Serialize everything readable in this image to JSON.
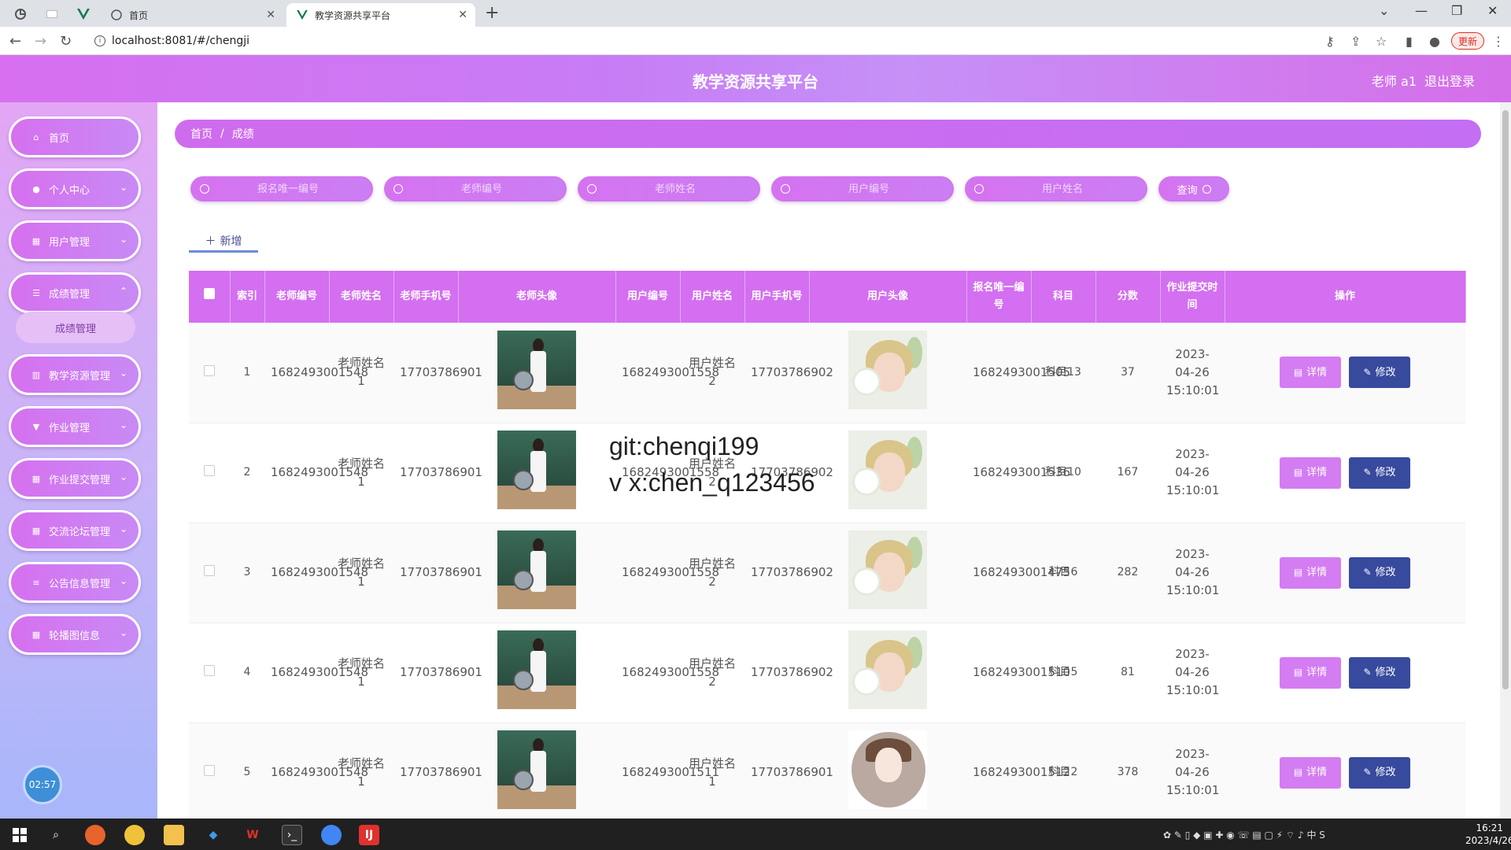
{
  "browser": {
    "tabs": [
      {
        "title": "首页"
      },
      {
        "title": "教学资源共享平台"
      }
    ],
    "url": "localhost:8081/#/chengji",
    "update_label": "更新"
  },
  "app": {
    "title": "教学资源共享平台",
    "user_label": "老师 a1",
    "logout_label": "退出登录"
  },
  "sidebar": {
    "items": [
      {
        "label": "首页",
        "icon": "home-icon"
      },
      {
        "label": "个人中心",
        "icon": "user-icon"
      },
      {
        "label": "用户管理",
        "icon": "grid-icon"
      },
      {
        "label": "成绩管理",
        "icon": "sliders-icon"
      },
      {
        "label": "教学资源管理",
        "icon": "chart-icon"
      },
      {
        "label": "作业管理",
        "icon": "pin-icon"
      },
      {
        "label": "作业提交管理",
        "icon": "grid-icon"
      },
      {
        "label": "交流论坛管理",
        "icon": "grid-icon"
      },
      {
        "label": "公告信息管理",
        "icon": "list-icon"
      },
      {
        "label": "轮播图信息",
        "icon": "grid-icon"
      }
    ],
    "submenu_label": "成绩管理",
    "clock": "02:57"
  },
  "breadcrumb": {
    "home": "首页",
    "separator": "/",
    "current": "成绩"
  },
  "search": {
    "fields": [
      {
        "placeholder": "报名唯一编号"
      },
      {
        "placeholder": "老师编号"
      },
      {
        "placeholder": "老师姓名"
      },
      {
        "placeholder": "用户编号"
      },
      {
        "placeholder": "用户姓名"
      }
    ],
    "query_label": "查询"
  },
  "add_label": "新增",
  "table": {
    "headers": [
      "索引",
      "老师编号",
      "老师姓名",
      "老师手机号",
      "老师头像",
      "用户编号",
      "用户姓名",
      "用户手机号",
      "用户头像",
      "报名唯一编号",
      "科目",
      "分数",
      "作业提交时间",
      "操作"
    ],
    "rows": [
      {
        "index": "1",
        "teacher_no": "1682493001548",
        "teacher_name": "老师姓名1",
        "teacher_phone": "17703786901",
        "user_no": "1682493001558",
        "user_name": "用户姓名2",
        "user_phone": "17703786902",
        "user_avatar": "boy",
        "signup_no": "1682493001505",
        "subject": "科目13",
        "score": "37",
        "time": "2023-04-26 15:10:01"
      },
      {
        "index": "2",
        "teacher_no": "1682493001548",
        "teacher_name": "老师姓名1",
        "teacher_phone": "17703786901",
        "user_no": "1682493001558",
        "user_name": "用户姓名2",
        "user_phone": "17703786902",
        "user_avatar": "boy",
        "signup_no": "1682493001536",
        "subject": "科目10",
        "score": "167",
        "time": "2023-04-26 15:10:01"
      },
      {
        "index": "3",
        "teacher_no": "1682493001548",
        "teacher_name": "老师姓名1",
        "teacher_phone": "17703786901",
        "user_no": "1682493001558",
        "user_name": "用户姓名2",
        "user_phone": "17703786902",
        "user_avatar": "boy",
        "signup_no": "1682493001475",
        "subject": "科目6",
        "score": "282",
        "time": "2023-04-26 15:10:01"
      },
      {
        "index": "4",
        "teacher_no": "1682493001548",
        "teacher_name": "老师姓名1",
        "teacher_phone": "17703786901",
        "user_no": "1682493001558",
        "user_name": "用户姓名2",
        "user_phone": "17703786902",
        "user_avatar": "boy",
        "signup_no": "1682493001510",
        "subject": "科目5",
        "score": "81",
        "time": "2023-04-26 15:10:01"
      },
      {
        "index": "5",
        "teacher_no": "1682493001548",
        "teacher_name": "老师姓名1",
        "teacher_phone": "17703786901",
        "user_no": "1682493001511",
        "user_name": "用户姓名1",
        "user_phone": "17703786901",
        "user_avatar": "girl",
        "signup_no": "1682493001512",
        "subject": "科目2",
        "score": "378",
        "time": "2023-04-26 15:10:01"
      }
    ],
    "detail_label": "详情",
    "edit_label": "修改"
  },
  "watermark": {
    "line1": "git:chenqi199",
    "line2": "v x:chen_q123456"
  },
  "taskbar": {
    "time": "16:21",
    "date": "2023/4/26"
  },
  "colors": {
    "header_purple": "#d76ff0",
    "table_header": "#d36ff0",
    "detail_button": "#d47cf2",
    "edit_button": "#384a9e"
  }
}
